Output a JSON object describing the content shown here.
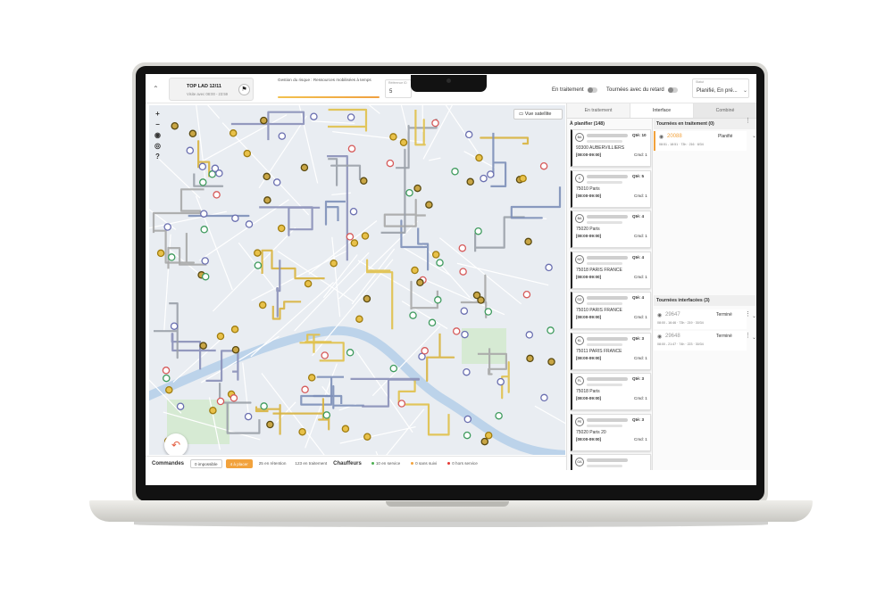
{
  "header": {
    "collapse_glyph": "⌃",
    "tour_title": "TOP LAD 12/11",
    "tour_subtitle": "Visite avec 08:00 - 23:59",
    "tour_icon": "flag-icon",
    "gestion_label": "Gestion du risque : Ressources mobilisées à temps",
    "field_label": "Référence ID",
    "field_value": "5",
    "toggle_en_traitement": "En traitement",
    "toggle_retard": "Tournées avec du retard",
    "status_label": "Statut",
    "status_value": "Planifié, En pré..."
  },
  "map": {
    "satellite_button": "Vue satellite",
    "tools": [
      "+",
      "−",
      "◉",
      "◎",
      "?"
    ],
    "fab_icon": "undo-icon"
  },
  "bottombar": {
    "commandes_label": "Commandes",
    "chips": [
      {
        "label": "0 impossible",
        "style": "outline"
      },
      {
        "label": "4 à placer",
        "style": "orange"
      },
      {
        "label": "25 en rétention",
        "style": "plain"
      },
      {
        "label": "123 en traitement",
        "style": "plain"
      }
    ],
    "chauffeurs_label": "Chauffeurs",
    "drivers": [
      {
        "label": "10 en service",
        "color": "#4caf50"
      },
      {
        "label": "0 sans suivi",
        "color": "#f2a23c"
      },
      {
        "label": "0 hors service",
        "color": "#e53935"
      }
    ]
  },
  "panel": {
    "tabs": [
      "En traitement",
      "Interface",
      "Combiné"
    ],
    "a_planifier_title": "À planifier (148)",
    "orders": [
      {
        "badge": "BA",
        "qty": "Qté: 10",
        "city": "93300 AUBERVILLIERS",
        "time": "[08:00-09:00]",
        "cmd": "Cmd: 1"
      },
      {
        "badge": "C",
        "qty": "Qté: 5",
        "city": "75010 Paris",
        "time": "[08:00-09:00]",
        "cmd": "Cmd: 1"
      },
      {
        "badge": "BA",
        "qty": "Qté: 4",
        "city": "75020 Paris",
        "time": "[08:00-09:00]",
        "cmd": "Cmd: 1"
      },
      {
        "badge": "NS",
        "qty": "Qté: 4",
        "city": "75018 PARIS FRANCE",
        "time": "[08:00-09:00]",
        "cmd": "Cmd: 1"
      },
      {
        "badge": "SG",
        "qty": "Qté: 4",
        "city": "75010 PARIS FRANCE",
        "time": "[08:00-09:00]",
        "cmd": "Cmd: 1"
      },
      {
        "badge": "KL",
        "qty": "Qté: 3",
        "city": "75011 PARIS FRANCE",
        "time": "[08:00-09:00]",
        "cmd": "Cmd: 1"
      },
      {
        "badge": "FL",
        "qty": "Qté: 3",
        "city": "75018 Paris",
        "time": "[08:00-09:00]",
        "cmd": "Cmd: 1"
      },
      {
        "badge": "PE",
        "qty": "Qté: 3",
        "city": "75020 Paris 20",
        "time": "[08:00-09:00]",
        "cmd": "Cmd: 1"
      },
      {
        "badge": "GA",
        "qty": "",
        "city": "",
        "time": "",
        "cmd": ""
      }
    ],
    "tournees_traitement_title": "Tournées en traitement (0)",
    "tournees_traitement": [
      {
        "id": "20088",
        "status": "Planifié",
        "meta": "08:51 - 18:51 · 73h · 216 · 8/34"
      }
    ],
    "tournees_interfacees_title": "Tournées interfacées (3)",
    "tournees_interfacees": [
      {
        "id": "29647",
        "status": "Terminé",
        "meta": "08:00 - 16:46 · 73h · 219 · 30/34"
      },
      {
        "id": "29648",
        "status": "Terminé",
        "meta": "08:00 - 21:47 · 74h · 223 · 30/34"
      }
    ]
  }
}
